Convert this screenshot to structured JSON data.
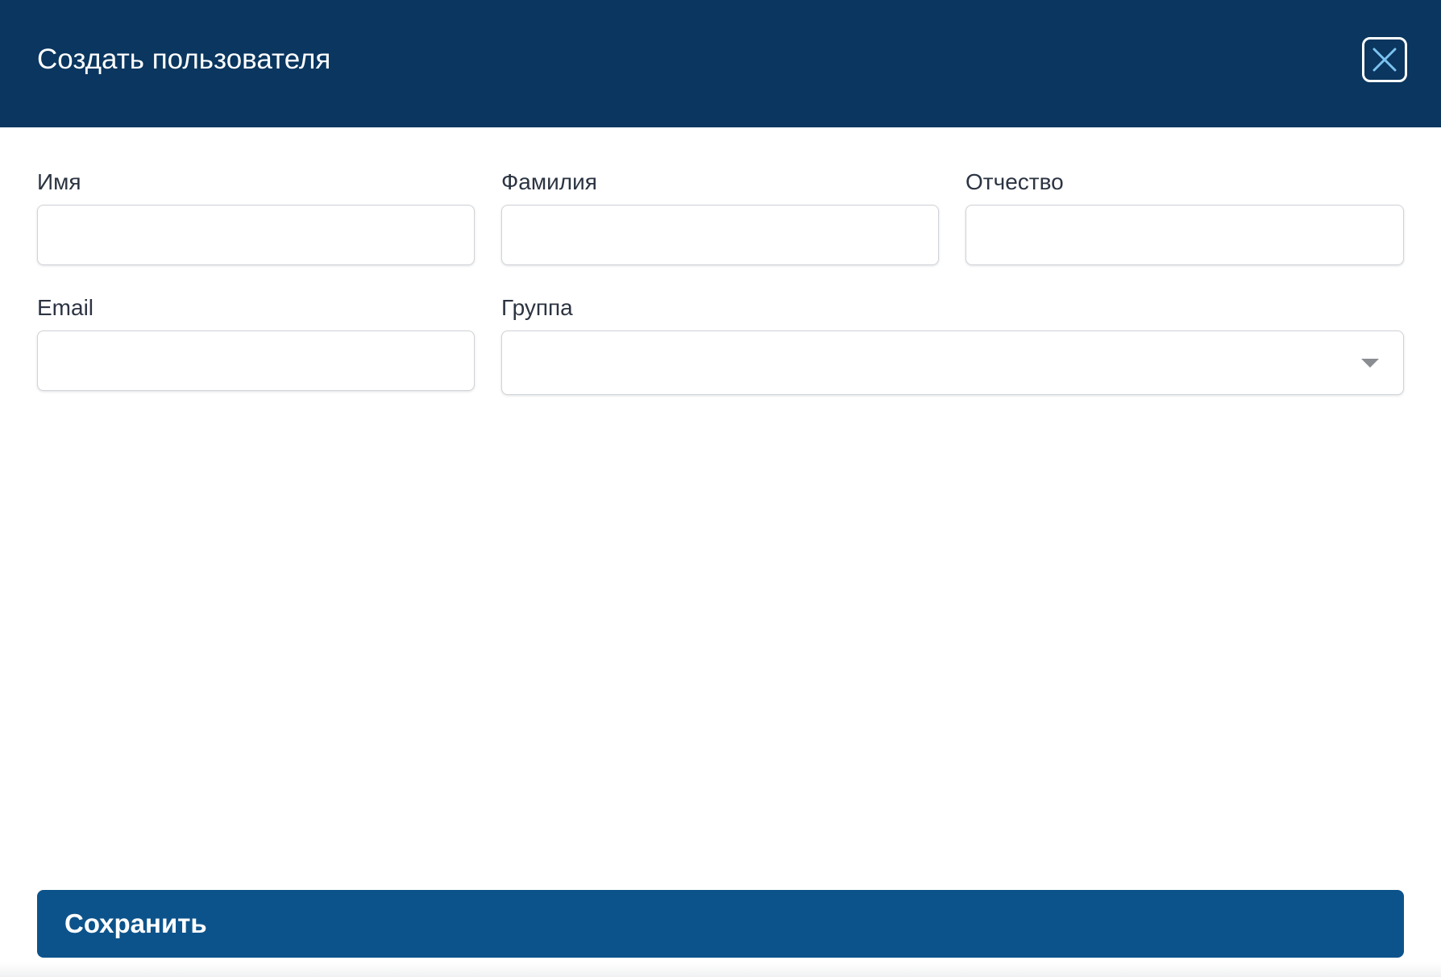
{
  "modal": {
    "title": "Создать пользователя"
  },
  "form": {
    "first_name": {
      "label": "Имя",
      "value": "",
      "placeholder": ""
    },
    "last_name": {
      "label": "Фамилия",
      "value": "",
      "placeholder": ""
    },
    "middle_name": {
      "label": "Отчество",
      "value": "",
      "placeholder": ""
    },
    "email": {
      "label": "Email",
      "value": "",
      "placeholder": ""
    },
    "group": {
      "label": "Группа",
      "selected": ""
    }
  },
  "actions": {
    "save_label": "Сохранить"
  },
  "icons": {
    "close": "close-icon",
    "dropdown": "chevron-down-icon"
  },
  "colors": {
    "header_bg": "#0a365f",
    "primary_button": "#0d538b",
    "close_icon_accent": "#7cc3f0"
  }
}
